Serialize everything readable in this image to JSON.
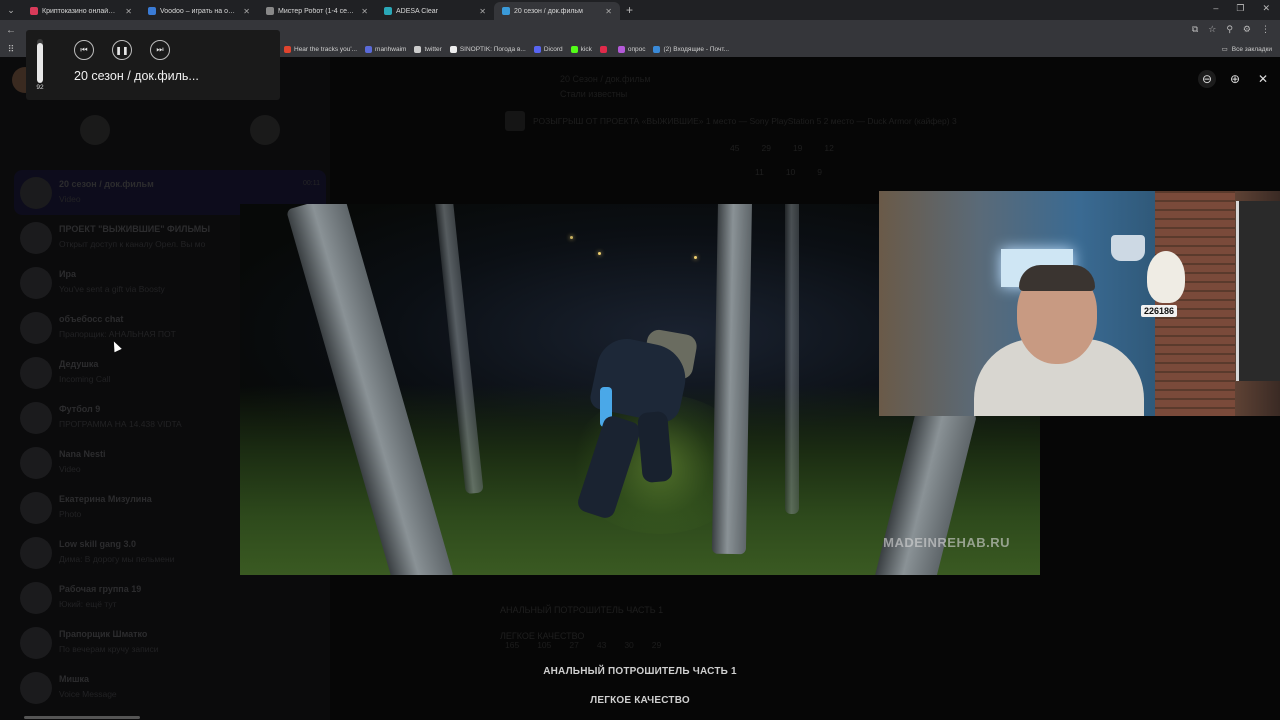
{
  "browser": {
    "tabs": [
      {
        "title": "Криптоказино онлайн VAVADA",
        "color": "#d93b5a",
        "active": false
      },
      {
        "title": "Voodoo – играть на официаль",
        "color": "#3a7bd5",
        "active": false
      },
      {
        "title": "Мистер Робот (1-4 сезон) смо",
        "color": "#888888",
        "active": false
      },
      {
        "title": "ADESA Clear",
        "color": "#2aa8b8",
        "active": false
      },
      {
        "title": "20 сезон / док.фильм",
        "color": "#3a9ad9",
        "active": true
      }
    ],
    "bookmarks": [
      {
        "label": "Hear the tracks you'...",
        "color": "#e0442e"
      },
      {
        "label": "manhwaim",
        "color": "#5a6ad8"
      },
      {
        "label": "twitter",
        "color": "#cccccc"
      },
      {
        "label": "SINOPTIK: Погода в...",
        "color": "#eeeeee"
      },
      {
        "label": "Dicord",
        "color": "#5865f2"
      },
      {
        "label": "kick",
        "color": "#53fc18"
      },
      {
        "label": "",
        "color": "#e02a4a"
      },
      {
        "label": "опрос",
        "color": "#b45ad8"
      },
      {
        "label": "(2) Входящие - Почт...",
        "color": "#3a8ad8"
      }
    ],
    "bookmarks_all": "Все закладки"
  },
  "media_flyout": {
    "volume": 92,
    "volume_label": "92",
    "title": "20 сезон / док.филь...",
    "prev_icon": "previous-track-icon",
    "pause_icon": "pause-icon",
    "next_icon": "next-track-icon"
  },
  "sidebar": {
    "chats": [
      {
        "name": "20 сезон / док.фильм",
        "msg": "Video",
        "time": "00:11",
        "selected": true
      },
      {
        "name": "ПРОЕКТ \"ВЫЖИВШИЕ\" ФИЛЬМЫ",
        "msg": "Открыт доступ к каналу Орел. Вы мо",
        "time": "",
        "selected": false
      },
      {
        "name": "Ира",
        "msg": "You've sent a gift via Boosty",
        "time": "",
        "selected": false
      },
      {
        "name": "объебосс chat",
        "msg": "Прапорщик: АНАЛЬНАЯ ПОТ",
        "time": "",
        "selected": false
      },
      {
        "name": "Дедушка",
        "msg": "Incoming Call",
        "time": "",
        "selected": false
      },
      {
        "name": "Футбол 9",
        "msg": "ПРОГРАММА НА 14.438 VIDTA",
        "time": "",
        "selected": false
      },
      {
        "name": "Nana Nesti",
        "msg": "Video",
        "time": "",
        "selected": false
      },
      {
        "name": "Екатерина Мизулина",
        "msg": "Photo",
        "time": "",
        "selected": false
      },
      {
        "name": "Low skill gang 3.0",
        "msg": "Дима: В дорогу мы пельмени",
        "time": "",
        "selected": false
      },
      {
        "name": "Рабочая группа 19",
        "msg": "Юкий: ещё тут",
        "time": "",
        "selected": false
      },
      {
        "name": "Прапорщик Шматко",
        "msg": "По вечерам кручу записи",
        "time": "",
        "selected": false
      },
      {
        "name": "Мишка",
        "msg": "Voice Message",
        "time": "",
        "selected": false
      }
    ]
  },
  "chat_main": {
    "header_title": "20 Сезон / док.фильм",
    "header_sub": "Стали известны",
    "pinned": "РОЗЫГРЫШ ОТ ПРОЕКТА «ВЫЖИВШИЕ»  1 место — Sony PlayStation 5  2 место — Duck Armor (кайфер)  3",
    "reactions_top": [
      "45",
      "29",
      "19",
      "12"
    ],
    "reactions_second": [
      "11",
      "10",
      "9"
    ],
    "reactions_bottom": [
      "165",
      "105",
      "27",
      "43",
      "30",
      "29"
    ]
  },
  "viewer": {
    "zoom_out_icon": "zoom-out-icon",
    "zoom_in_icon": "zoom-in-icon",
    "close_icon": "close-icon",
    "watermark": "MADEINREHAB.RU",
    "webcam_plate": "226186",
    "caption_line1": "АНАЛЬНЫЙ ПОТРОШИТЕЛЬ ЧАСТЬ 1",
    "caption_line2": "ЛЕГКОЕ КАЧЕСТВО"
  }
}
